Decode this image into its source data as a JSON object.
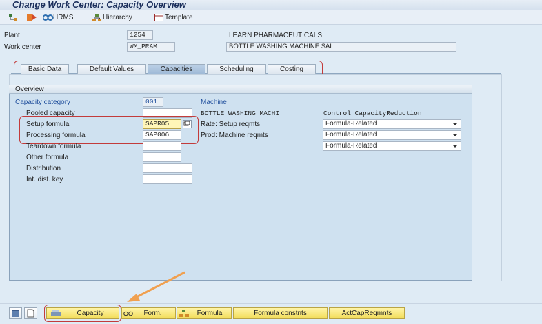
{
  "window": {
    "title": "Change Work Center: Capacity Overview"
  },
  "toolbar": {
    "hrms_label": "HRMS",
    "hierarchy_label": "Hierarchy",
    "template_label": "Template"
  },
  "header": {
    "plant_label": "Plant",
    "plant_value": "1254",
    "plant_desc": "LEARN PHARMACEUTICALS",
    "wc_label": "Work center",
    "wc_value": "WM_PRAM",
    "wc_desc": "BOTTLE WASHING MACHINE SAL"
  },
  "tabs": [
    "Basic Data",
    "Default Values",
    "Capacities",
    "Scheduling",
    "Costing"
  ],
  "overview": {
    "title": "Overview",
    "capcat_label": "Capacity category",
    "capcat_value": "001",
    "capcat_desc": "Machine",
    "pooled_label": "Pooled capacity",
    "pooled_value": "",
    "pooled_desc": "BOTTLE WASHING MACHI",
    "control_label": "Control CapacityReduction",
    "setup_label": "Setup formula",
    "setup_value": "SAPR05",
    "setup_rate_label": "Rate: Setup reqmts",
    "setup_rate_value": "Formula-Related",
    "proc_label": "Processing formula",
    "proc_value": "SAP006",
    "proc_rate_label": "Prod: Machine reqmts",
    "proc_rate_value": "Formula-Related",
    "teardown_label": "Teardown formula",
    "teardown_value": "",
    "third_rate_value": "Formula-Related",
    "other_label": "Other formula",
    "other_value": "",
    "dist_label": "Distribution",
    "dist_value": "",
    "intdist_label": "Int. dist. key",
    "intdist_value": ""
  },
  "buttons": {
    "capacity": "Capacity",
    "form": "Form.",
    "formula": "Formula",
    "formula_constnts": "Formula constnts",
    "actcap": "ActCapReqmnts"
  },
  "colors": {
    "highlight_red": "#c33b3b",
    "arrow_orange": "#f0a050",
    "button_yellow": "#f2dd5a"
  }
}
